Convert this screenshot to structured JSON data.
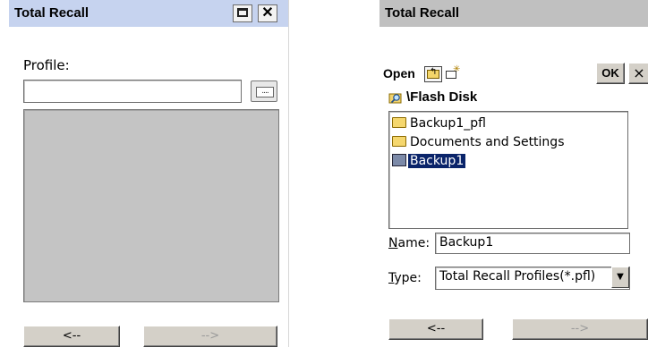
{
  "left_window": {
    "title": "Total Recall",
    "profile_label": "Profile:",
    "profile_value": "",
    "browse_label": "....",
    "back_label": "<--",
    "next_label": "-->"
  },
  "right_window": {
    "title": "Total Recall",
    "open_label": "Open",
    "ok_label": "OK",
    "close_label": "×",
    "path": "\\Flash Disk",
    "files": [
      {
        "name": "Backup1_pfl",
        "kind": "folder"
      },
      {
        "name": "Documents and Settings",
        "kind": "folder"
      },
      {
        "name": "Backup1",
        "kind": "file"
      }
    ],
    "name_label_first": "N",
    "name_label_rest": "ame:",
    "name_value": "Backup1",
    "type_label_first": "T",
    "type_label_rest": "ype:",
    "type_value": "Total Recall Profiles(*.pfl)",
    "back_label": "<--",
    "next_label": "-->"
  },
  "icons": {
    "maximize": "maximize-icon",
    "close": "close-icon",
    "up_folder": "folder-up-icon",
    "new_folder": "new-folder-icon",
    "path": "search-folder-icon",
    "dropdown": "chevron-down-icon"
  }
}
